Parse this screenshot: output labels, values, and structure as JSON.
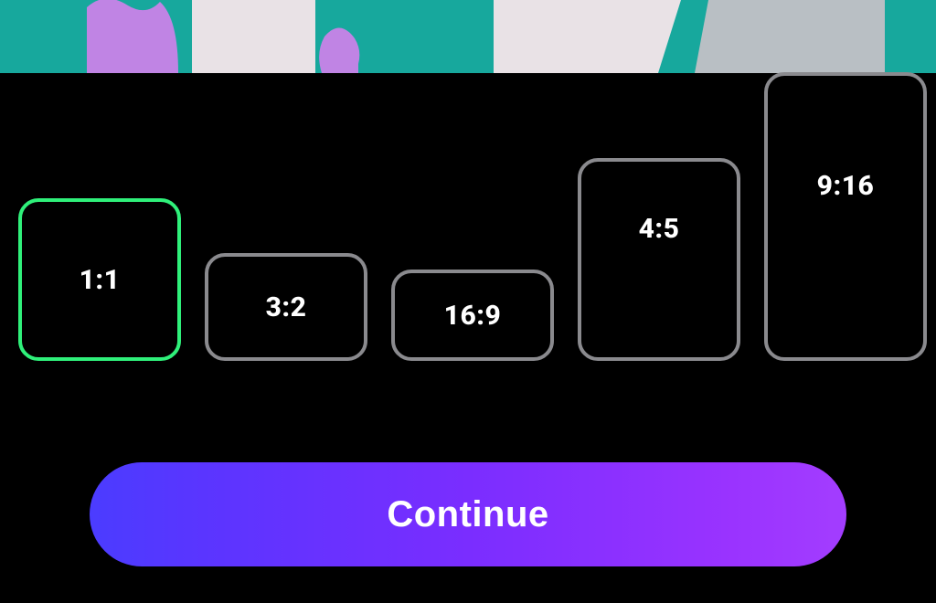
{
  "banner_colors": {
    "bg": "#17a89d",
    "shape1": "#c084e4",
    "shape2": "#e9e2e6",
    "shape3": "#b9bfc4"
  },
  "aspect_ratios": {
    "selected": "1:1",
    "options": [
      {
        "label": "1:1",
        "key": "1-1"
      },
      {
        "label": "3:2",
        "key": "3-2"
      },
      {
        "label": "16:9",
        "key": "16-9"
      },
      {
        "label": "4:5",
        "key": "4-5"
      },
      {
        "label": "9:16",
        "key": "9-16"
      }
    ]
  },
  "continue_label": "Continue"
}
